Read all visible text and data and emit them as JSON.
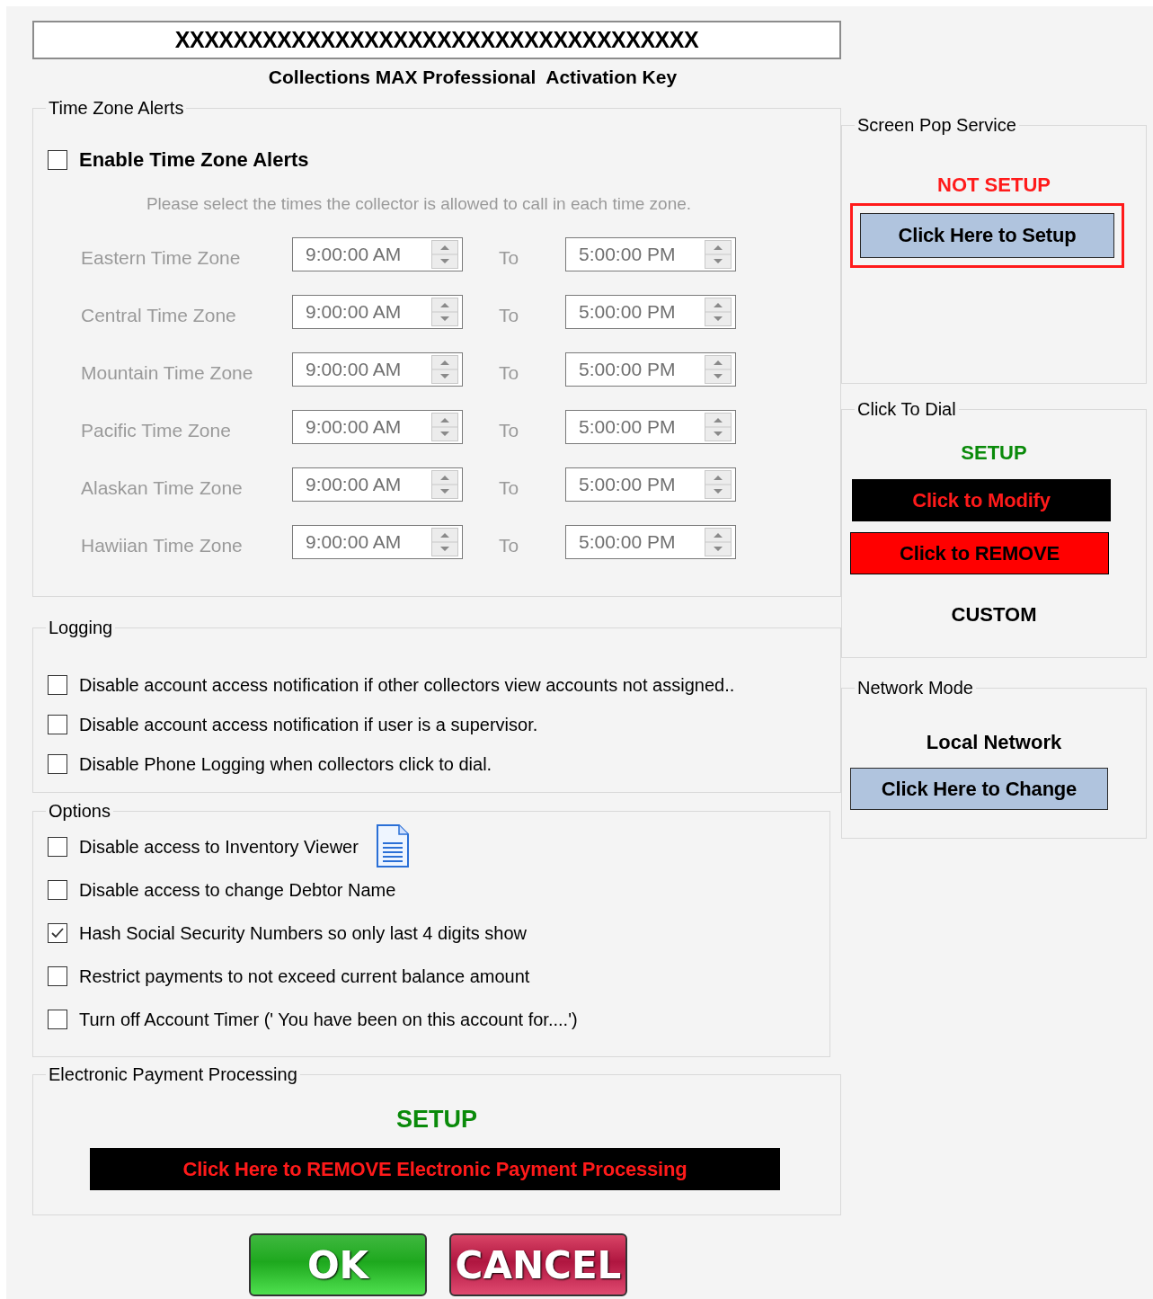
{
  "activation": {
    "key": "XXXXXXXXXXXXXXXXXXXXXXXXXXXXXXXXXXXX",
    "caption": "Collections MAX Professional  Activation Key"
  },
  "time_zone_alerts": {
    "legend": "Time Zone Alerts",
    "enable": {
      "label": "Enable Time Zone Alerts",
      "checked": false
    },
    "hint": "Please select the times the collector is allowed to call in each time zone.",
    "disabled": true,
    "zones": [
      {
        "name": "Eastern Time Zone",
        "from": "9:00:00 AM",
        "separator": "To",
        "to": "5:00:00 PM"
      },
      {
        "name": "Central Time Zone",
        "from": "9:00:00 AM",
        "separator": "To",
        "to": "5:00:00 PM"
      },
      {
        "name": "Mountain Time Zone",
        "from": "9:00:00 AM",
        "separator": "To",
        "to": "5:00:00 PM"
      },
      {
        "name": "Pacific Time Zone",
        "from": "9:00:00 AM",
        "separator": "To",
        "to": "5:00:00 PM"
      },
      {
        "name": "Alaskan Time Zone",
        "from": "9:00:00 AM",
        "separator": "To",
        "to": "5:00:00 PM"
      },
      {
        "name": "Hawiian Time Zone",
        "from": "9:00:00 AM",
        "separator": "To",
        "to": "5:00:00 PM"
      }
    ]
  },
  "logging": {
    "legend": "Logging",
    "items": [
      {
        "label": "Disable account access notification if other collectors view accounts not assigned..",
        "checked": false
      },
      {
        "label": "Disable account access notification if user is a supervisor.",
        "checked": false
      },
      {
        "label": "Disable Phone Logging when collectors click to dial.",
        "checked": false
      }
    ]
  },
  "options": {
    "legend": "Options",
    "items": [
      {
        "label": "Disable access to Inventory Viewer",
        "checked": false,
        "kind": "with_icon"
      },
      {
        "label": "Disable access to change Debtor Name",
        "checked": false,
        "kind": "plain"
      },
      {
        "label": "Hash Social Security Numbers so only last 4 digits show",
        "checked": true,
        "kind": "plain"
      },
      {
        "label": "Restrict payments to not exceed current balance amount",
        "checked": false,
        "kind": "plain"
      },
      {
        "label": "Turn off Account Timer  (' You have been on this account for....')",
        "checked": false,
        "kind": "plain"
      }
    ]
  },
  "electronic_payment": {
    "legend": "Electronic Payment Processing",
    "status": {
      "text": "SETUP",
      "color": "#0a8a0a"
    },
    "button": {
      "label": "Click Here to REMOVE Electronic Payment Processing",
      "kind": "black_button"
    }
  },
  "side_panels": [
    {
      "legend": "Screen Pop Service",
      "items": [
        {
          "kind": "status",
          "text": "NOT SETUP",
          "color": "#ff1a1a"
        },
        {
          "kind": "outlined_button",
          "label": "Click Here to Setup"
        }
      ]
    },
    {
      "legend": "Click To Dial",
      "items": [
        {
          "kind": "status",
          "text": "SETUP",
          "color": "#0a8a0a"
        },
        {
          "kind": "black_button",
          "label": "Click to Modify"
        },
        {
          "kind": "red_button",
          "label": "Click to REMOVE"
        },
        {
          "kind": "status",
          "text": "CUSTOM",
          "color": "#000000"
        }
      ]
    },
    {
      "legend": "Network Mode",
      "items": [
        {
          "kind": "status",
          "text": "Local Network",
          "color": "#000000"
        },
        {
          "kind": "blue_button",
          "label": "Click Here to Change"
        }
      ]
    }
  ],
  "footer_buttons": [
    {
      "label": "OK",
      "kind": "ok"
    },
    {
      "label": "CANCEL",
      "kind": "cancel"
    }
  ]
}
